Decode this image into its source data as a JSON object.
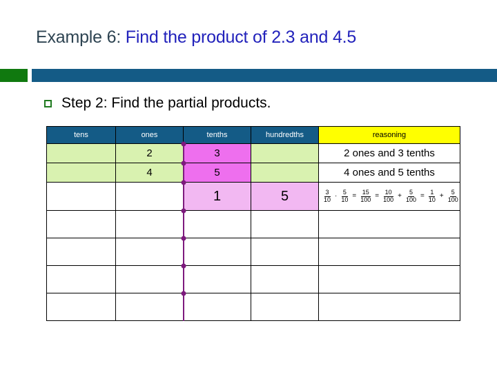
{
  "slide": {
    "title_part1": "Example 6:",
    "title_part2": " Find the product of 2.3 and 4.5",
    "step_text": "Step 2: Find the partial products.",
    "accent_green_color": "#10790f",
    "accent_blue_color": "#145b86",
    "bullet_color": "#1f7a1f",
    "title_color_1": "#2e4452",
    "title_color_2": "#2222bb"
  },
  "table": {
    "headers": {
      "tens": "tens",
      "ones": "ones",
      "tenths": "tenths",
      "hundredths": "hundredths",
      "reasoning": "reasoning"
    },
    "header_bg": "#145b86",
    "header_reasoning_bg": "#ffff00",
    "rows": [
      {
        "tens": "",
        "ones": "2",
        "tenths": "3",
        "hundredths": "",
        "reasoning": "2 ones and 3 tenths"
      },
      {
        "tens": "",
        "ones": "4",
        "tenths": "5",
        "hundredths": "",
        "reasoning": "4 ones and 5 tenths"
      },
      {
        "tens": "",
        "ones": "",
        "tenths": "1",
        "hundredths": "5",
        "reasoning": "equation"
      }
    ],
    "blank_row_count": 4,
    "equation": {
      "f1": {
        "num": "3",
        "den": "10"
      },
      "op1": "·",
      "f2": {
        "num": "5",
        "den": "10"
      },
      "op2": "=",
      "f3": {
        "num": "15",
        "den": "100"
      },
      "op3": "=",
      "f4": {
        "num": "10",
        "den": "100"
      },
      "op4": "+",
      "f5": {
        "num": "5",
        "den": "100"
      },
      "op5": "=",
      "f6": {
        "num": "1",
        "den": "10"
      },
      "op6": "+",
      "f7": {
        "num": "5",
        "den": "100"
      }
    },
    "colors": {
      "green_cell": "#d9f2b0",
      "pink_cell": "#ee6fee",
      "violet_cell": "#f2b8f2",
      "decimal_dot": "#7d1a7d"
    }
  }
}
